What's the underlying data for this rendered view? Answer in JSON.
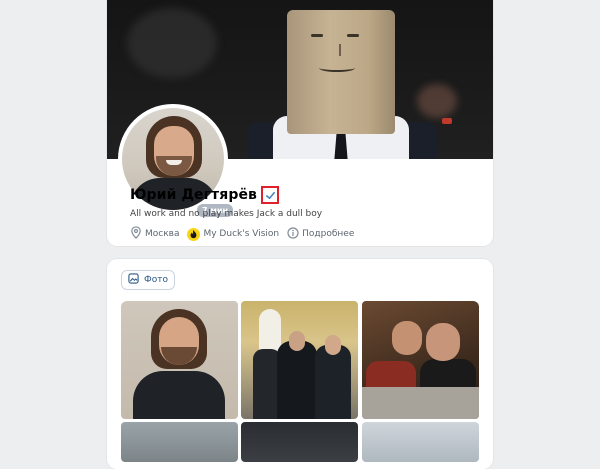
{
  "profile": {
    "name": "Юрий Дегтярёв",
    "online_badge": "7 мин",
    "status": "All work and no play makes Jack a dull boy",
    "location": "Москва",
    "community": "My Duck's Vision",
    "more_label": "Подробнее",
    "verified_icon": "verified-check-icon"
  },
  "photos": {
    "tab_label": "Фото",
    "tab_icon": "image-icon"
  },
  "colors": {
    "accent": "#2a5885",
    "page_bg": "#edeef0",
    "verified": "#4a86c5",
    "highlight_box": "#e0202a",
    "community_badge": "#f7d415"
  }
}
